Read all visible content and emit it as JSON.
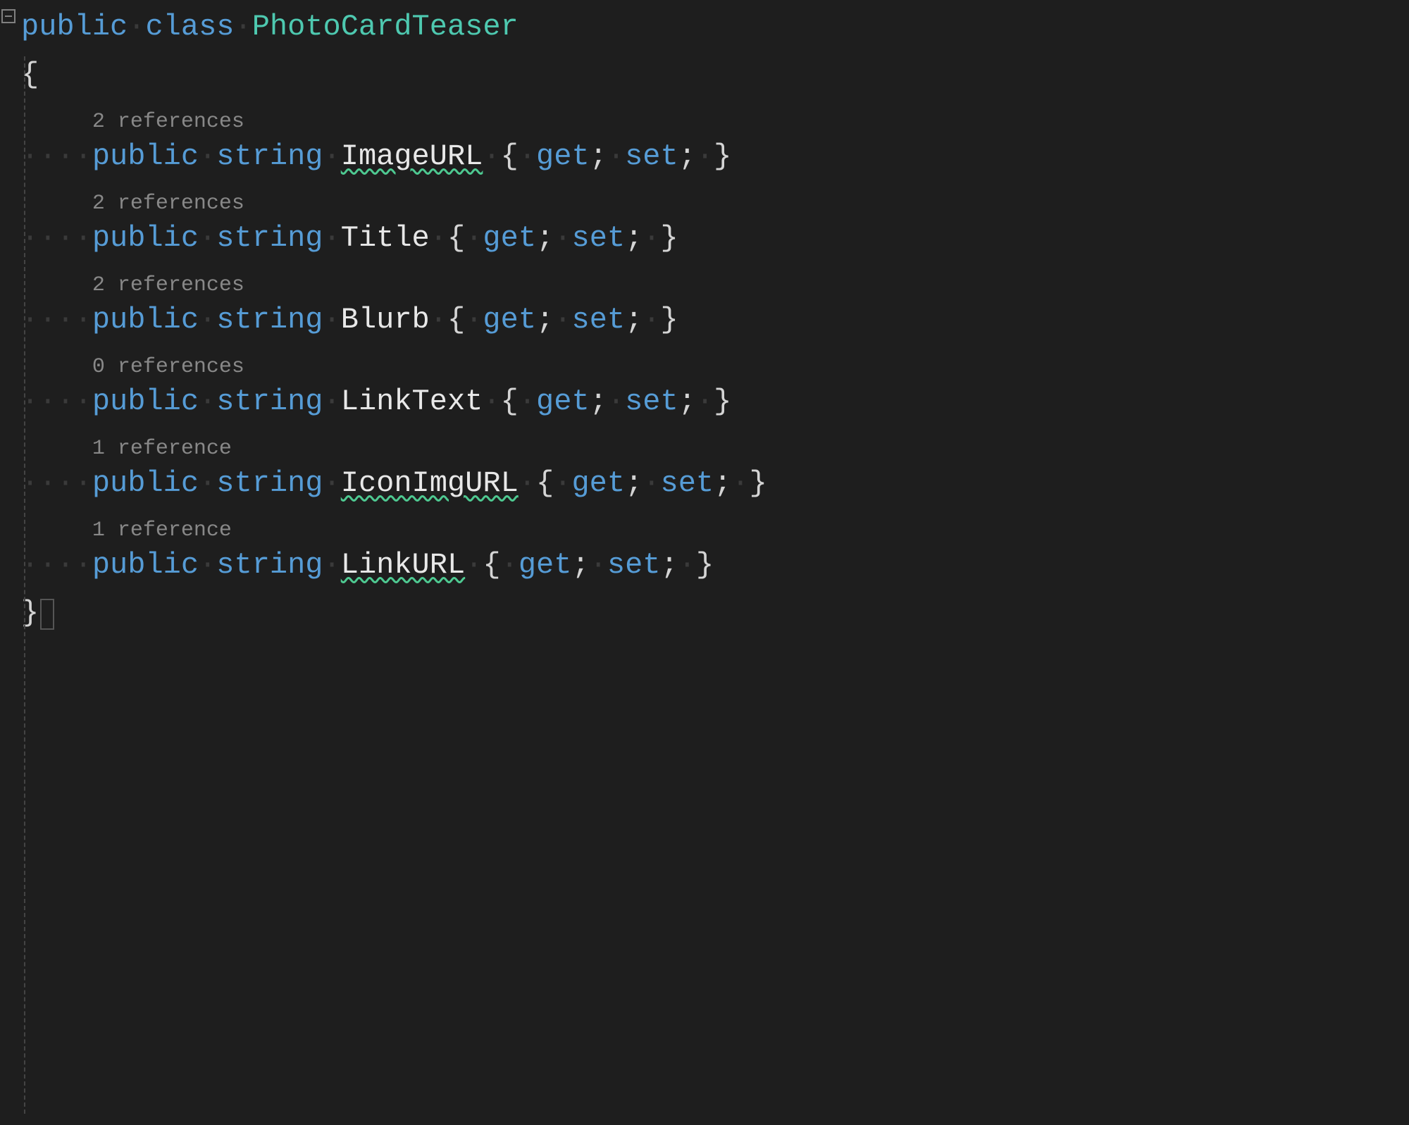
{
  "class_decl": {
    "modifier": "public",
    "keyword": "class",
    "name": "PhotoCardTeaser"
  },
  "properties": [
    {
      "references": "2 references",
      "modifier": "public",
      "type": "string",
      "name": "ImageURL",
      "accessors": "{ get; set; }",
      "squiggle": true,
      "blank_after": true
    },
    {
      "references": "2 references",
      "modifier": "public",
      "type": "string",
      "name": "Title",
      "accessors": "{ get; set; }",
      "squiggle": false,
      "blank_after": false
    },
    {
      "references": "2 references",
      "modifier": "public",
      "type": "string",
      "name": "Blurb",
      "accessors": "{ get; set; }",
      "squiggle": false,
      "blank_after": false
    },
    {
      "references": "0 references",
      "modifier": "public",
      "type": "string",
      "name": "LinkText",
      "accessors": "{ get; set; }",
      "squiggle": false,
      "blank_after": false
    },
    {
      "references": "1 reference",
      "modifier": "public",
      "type": "string",
      "name": "IconImgURL",
      "accessors": "{ get; set; }",
      "squiggle": true,
      "blank_after": false
    },
    {
      "references": "1 reference",
      "modifier": "public",
      "type": "string",
      "name": "LinkURL",
      "accessors": "{ get; set; }",
      "squiggle": true,
      "blank_after": false
    }
  ],
  "indent_dots": "····",
  "codelens_indent": "    "
}
